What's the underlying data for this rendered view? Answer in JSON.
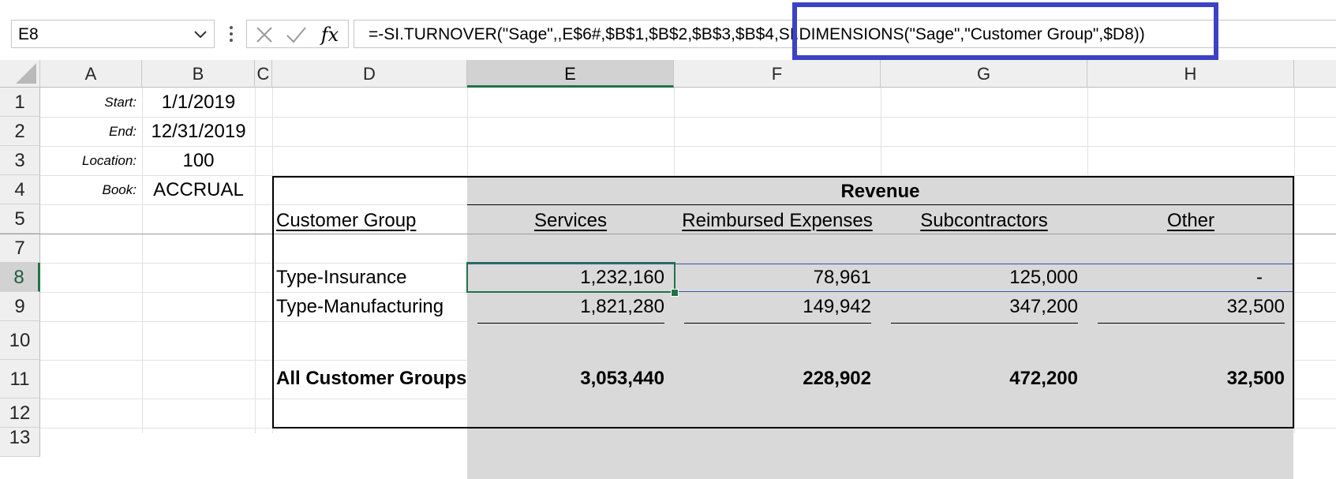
{
  "formula_bar": {
    "name_box": "E8",
    "fx_label": "fx",
    "formula": "=-SI.TURNOVER(\"Sage\",,E$6#,$B$1,$B$2,$B$3,$B$4,SI.DIMENSIONS(\"Sage\",\"Customer Group\",$D8))"
  },
  "grid": {
    "columns": [
      "A",
      "B",
      "C",
      "D",
      "E",
      "F",
      "G",
      "H"
    ],
    "active_column": "E",
    "rows": [
      "1",
      "2",
      "3",
      "4",
      "5",
      "7",
      "8",
      "9",
      "10",
      "11",
      "12",
      "13"
    ],
    "active_row": "8"
  },
  "params": [
    {
      "label": "Start:",
      "value": "1/1/2019"
    },
    {
      "label": "End:",
      "value": "12/31/2019"
    },
    {
      "label": "Location:",
      "value": "100"
    },
    {
      "label": "Book:",
      "value": "ACCRUAL"
    }
  ],
  "report": {
    "group_title": "Revenue",
    "row_header": "Customer Group",
    "columns": [
      "Services",
      "Reimbursed Expenses",
      "Subcontractors",
      "Other"
    ],
    "rows": [
      {
        "label": "Type-Insurance",
        "values": [
          "1,232,160",
          "78,961",
          "125,000",
          "-"
        ]
      },
      {
        "label": "Type-Manufacturing",
        "values": [
          "1,821,280",
          "149,942",
          "347,200",
          "32,500"
        ]
      }
    ],
    "total": {
      "label": "All Customer Groups",
      "values": [
        "3,053,440",
        "228,902",
        "472,200",
        "32,500"
      ]
    }
  },
  "colors": {
    "highlight": "#3b42c4",
    "selection": "#217346",
    "table_shade": "#d9d9d9"
  }
}
